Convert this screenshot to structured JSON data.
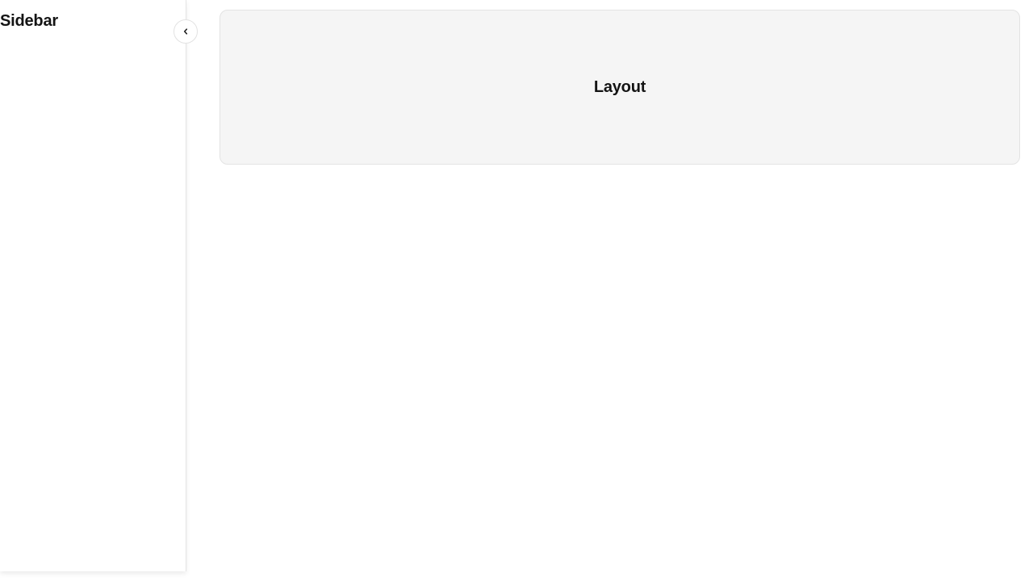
{
  "sidebar": {
    "title": "Sidebar",
    "collapse_icon": "chevron-left-icon"
  },
  "main": {
    "card_title": "Layout"
  }
}
